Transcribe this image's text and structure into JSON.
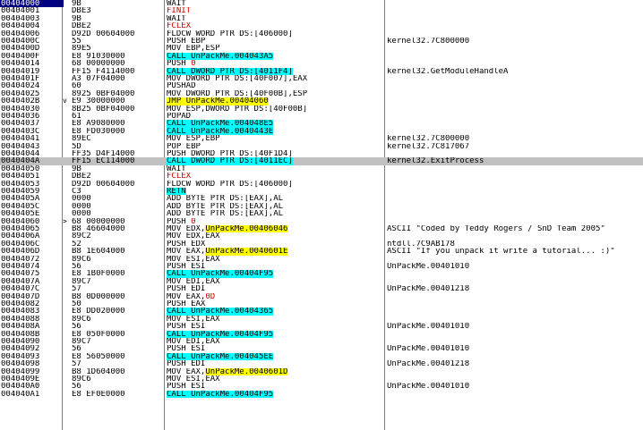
{
  "rows": [
    {
      "addr": "00404000",
      "hex": "9B",
      "mn": "WAIT",
      "cm": "",
      "kind": "plain",
      "sel": true
    },
    {
      "addr": "00404001",
      "hex": "DBE3",
      "mn": "FINIT",
      "cm": "",
      "kind": "red"
    },
    {
      "addr": "00404003",
      "hex": "9B",
      "mn": "WAIT",
      "cm": "",
      "kind": "plain"
    },
    {
      "addr": "00404004",
      "hex": "DBE2",
      "mn": "FCLEX",
      "cm": "",
      "kind": "red"
    },
    {
      "addr": "00404006",
      "hex": "D92D 00604000",
      "mn": "FLDCW WORD PTR DS:[406000]",
      "cm": "",
      "kind": "plain"
    },
    {
      "addr": "0040400C",
      "hex": "55",
      "mn": "PUSH EBP",
      "cm": "kernel32.7C800000",
      "kind": "plain"
    },
    {
      "addr": "0040400D",
      "hex": "89E5",
      "mn": "MOV EBP,ESP",
      "cm": "",
      "kind": "plain"
    },
    {
      "addr": "0040400F",
      "hex": "E8 91030000",
      "mn": "CALL ",
      "tgt": "UnPackMe.004043A5",
      "cm": "",
      "kind": "call"
    },
    {
      "addr": "00404014",
      "hex": "68 00000000",
      "mn": "PUSH ",
      "red": "0",
      "cm": "",
      "kind": "pushred"
    },
    {
      "addr": "00404019",
      "hex": "FF15 F4114000",
      "mn": "CALL DWORD PTR DS:[4011F4]",
      "cm": "kernel32.GetModuleHandleA",
      "kind": "call"
    },
    {
      "addr": "0040401F",
      "hex": "A3 07F04000",
      "mn": "MOV DWORD PTR DS:[40F007],EAX",
      "cm": "",
      "kind": "plain"
    },
    {
      "addr": "00404024",
      "hex": "60",
      "mn": "PUSHAD",
      "cm": "",
      "kind": "plain"
    },
    {
      "addr": "00404025",
      "hex": "8925 0BF04000",
      "mn": "MOV DWORD PTR DS:[40F00B],ESP",
      "cm": "",
      "kind": "plain"
    },
    {
      "addr": "0040402B",
      "hex": "E9 30000000",
      "mn": "JMP ",
      "tgt": "UnPackMe.00404060",
      "cm": "",
      "kind": "jump",
      "jmp": "v"
    },
    {
      "addr": "00404030",
      "hex": "8B25 0BF04000",
      "mn": "MOV ESP,DWORD PTR DS:[40F00B]",
      "cm": "",
      "kind": "plain"
    },
    {
      "addr": "00404036",
      "hex": "61",
      "mn": "POPAD",
      "cm": "",
      "kind": "plain"
    },
    {
      "addr": "00404037",
      "hex": "E8 A9080000",
      "mn": "CALL ",
      "tgt": "UnPackMe.004048E5",
      "cm": "",
      "kind": "call"
    },
    {
      "addr": "0040403C",
      "hex": "E8 FD030000",
      "mn": "CALL ",
      "tgt": "UnPackMe.0040443E",
      "cm": "",
      "kind": "call"
    },
    {
      "addr": "00404041",
      "hex": "89EC",
      "mn": "MOV ESP,EBP",
      "cm": "kernel32.7C800000",
      "kind": "plain"
    },
    {
      "addr": "00404043",
      "hex": "5D",
      "mn": "POP EBP",
      "cm": "kernel32.7C817067",
      "kind": "plain"
    },
    {
      "addr": "00404044",
      "hex": "FF35 D4F14000",
      "mn": "PUSH DWORD PTR DS:[40F1D4]",
      "cm": "",
      "kind": "plain"
    },
    {
      "addr": "0040404A",
      "hex": "FF15 EC114000",
      "mn": "CALL DWORD PTR DS:[4011EC]",
      "cm": "kernel32.ExitProcess",
      "kind": "call",
      "hl": true
    },
    {
      "addr": "00404050",
      "hex": "9B",
      "mn": "WAIT",
      "cm": "",
      "kind": "plain"
    },
    {
      "addr": "00404051",
      "hex": "DBE2",
      "mn": "FCLEX",
      "cm": "",
      "kind": "red"
    },
    {
      "addr": "00404053",
      "hex": "D92D 00604000",
      "mn": "FLDCW WORD PTR DS:[406000]",
      "cm": "",
      "kind": "plain"
    },
    {
      "addr": "00404059",
      "hex": "C3",
      "mn": "RETN",
      "cm": "",
      "kind": "call"
    },
    {
      "addr": "0040405A",
      "hex": "0000",
      "mn": "ADD BYTE PTR DS:[EAX],AL",
      "cm": "",
      "kind": "plain"
    },
    {
      "addr": "0040405C",
      "hex": "0000",
      "mn": "ADD BYTE PTR DS:[EAX],AL",
      "cm": "",
      "kind": "plain"
    },
    {
      "addr": "0040405E",
      "hex": "0000",
      "mn": "ADD BYTE PTR DS:[EAX],AL",
      "cm": "",
      "kind": "plain"
    },
    {
      "addr": "00404060",
      "hex": "68 00000000",
      "mn": "PUSH ",
      "red": "0",
      "cm": "",
      "kind": "pushred",
      "jmp": ">"
    },
    {
      "addr": "00404065",
      "hex": "B8 46604000",
      "mn": "MOV EDX,",
      "tgt": "UnPackMe.00406046",
      "cm": "ASCII \"Coded by Teddy Rogers / SnD Team 2005\"",
      "kind": "movtgt"
    },
    {
      "addr": "0040406A",
      "hex": "89C2",
      "mn": "MOV EDX,EAX",
      "cm": "",
      "kind": "plain"
    },
    {
      "addr": "0040406C",
      "hex": "52",
      "mn": "PUSH EDX",
      "cm": "ntdll.7C9AB178",
      "kind": "plain"
    },
    {
      "addr": "0040406D",
      "hex": "B8 1E604000",
      "mn": "MOV EAX,",
      "tgt": "UnPackMe.0040601E",
      "cm": "ASCII \"If you unpack it write a tutorial... :)\"",
      "kind": "movtgt"
    },
    {
      "addr": "00404072",
      "hex": "89C6",
      "mn": "MOV ESI,EAX",
      "cm": "",
      "kind": "plain"
    },
    {
      "addr": "00404074",
      "hex": "56",
      "mn": "PUSH ESI",
      "cm": "UnPackMe.00401010",
      "kind": "plain"
    },
    {
      "addr": "00404075",
      "hex": "E8 1B0F0000",
      "mn": "CALL ",
      "tgt": "UnPackMe.00404F95",
      "cm": "",
      "kind": "call"
    },
    {
      "addr": "0040407A",
      "hex": "89C7",
      "mn": "MOV EDI,EAX",
      "cm": "",
      "kind": "plain"
    },
    {
      "addr": "0040407C",
      "hex": "57",
      "mn": "PUSH EDI",
      "cm": "UnPackMe.00401218",
      "kind": "plain"
    },
    {
      "addr": "0040407D",
      "hex": "B8 0D000000",
      "mn": "MOV EAX,",
      "red": "0D",
      "cm": "",
      "kind": "pushred"
    },
    {
      "addr": "00404082",
      "hex": "50",
      "mn": "PUSH EAX",
      "cm": "",
      "kind": "plain"
    },
    {
      "addr": "00404083",
      "hex": "E8 DD020000",
      "mn": "CALL ",
      "tgt": "UnPackMe.00404365",
      "cm": "",
      "kind": "call"
    },
    {
      "addr": "00404088",
      "hex": "89C6",
      "mn": "MOV ESI,EAX",
      "cm": "",
      "kind": "plain"
    },
    {
      "addr": "0040408A",
      "hex": "56",
      "mn": "PUSH ESI",
      "cm": "UnPackMe.00401010",
      "kind": "plain"
    },
    {
      "addr": "0040408B",
      "hex": "E8 050F0000",
      "mn": "CALL ",
      "tgt": "UnPackMe.00404F95",
      "cm": "",
      "kind": "call"
    },
    {
      "addr": "00404090",
      "hex": "89C7",
      "mn": "MOV EDI,EAX",
      "cm": "",
      "kind": "plain"
    },
    {
      "addr": "00404092",
      "hex": "56",
      "mn": "PUSH ESI",
      "cm": "UnPackMe.00401010",
      "kind": "plain"
    },
    {
      "addr": "00404093",
      "hex": "E8 56050000",
      "mn": "CALL ",
      "tgt": "UnPackMe.004045EE",
      "cm": "",
      "kind": "call"
    },
    {
      "addr": "00404098",
      "hex": "57",
      "mn": "PUSH EDI",
      "cm": "UnPackMe.00401218",
      "kind": "plain"
    },
    {
      "addr": "00404099",
      "hex": "B8 1D604000",
      "mn": "MOV EAX,",
      "tgt": "UnPackMe.0040601D",
      "cm": "",
      "kind": "movtgt"
    },
    {
      "addr": "0040409E",
      "hex": "89C6",
      "mn": "MOV ESI,EAX",
      "cm": "",
      "kind": "plain"
    },
    {
      "addr": "004040A0",
      "hex": "56",
      "mn": "PUSH ESI",
      "cm": "UnPackMe.00401010",
      "kind": "plain"
    },
    {
      "addr": "004040A1",
      "hex": "E8 EF0E0000",
      "mn": "CALL ",
      "tgt": "UnPackMe.00404F95",
      "cm": "",
      "kind": "call"
    }
  ]
}
